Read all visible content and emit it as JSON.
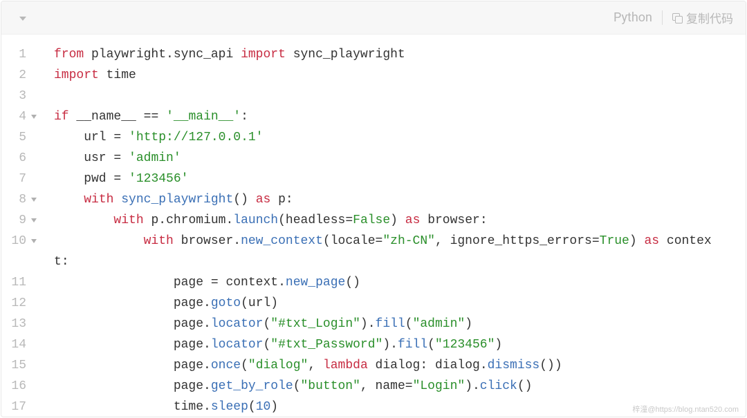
{
  "toolbar": {
    "language_label": "Python",
    "copy_label": "复制代码"
  },
  "code": {
    "lines": [
      {
        "n": "1",
        "fold": false,
        "tokens": [
          [
            "kw",
            "from"
          ],
          [
            "id",
            " playwright"
          ],
          [
            "op",
            "."
          ],
          [
            "id",
            "sync_api "
          ],
          [
            "kw",
            "import"
          ],
          [
            "id",
            " sync_playwright"
          ]
        ]
      },
      {
        "n": "2",
        "fold": false,
        "tokens": [
          [
            "kw",
            "import"
          ],
          [
            "id",
            " time"
          ]
        ]
      },
      {
        "n": "3",
        "fold": false,
        "tokens": []
      },
      {
        "n": "4",
        "fold": true,
        "tokens": [
          [
            "kw",
            "if"
          ],
          [
            "id",
            " __name__ "
          ],
          [
            "op",
            "=="
          ],
          [
            "id",
            " "
          ],
          [
            "str",
            "'__main__'"
          ],
          [
            "op",
            ":"
          ]
        ]
      },
      {
        "n": "5",
        "fold": false,
        "tokens": [
          [
            "id",
            "    url "
          ],
          [
            "op",
            "="
          ],
          [
            "id",
            " "
          ],
          [
            "str",
            "'http://127.0.0.1'"
          ]
        ]
      },
      {
        "n": "6",
        "fold": false,
        "tokens": [
          [
            "id",
            "    usr "
          ],
          [
            "op",
            "="
          ],
          [
            "id",
            " "
          ],
          [
            "str",
            "'admin'"
          ]
        ]
      },
      {
        "n": "7",
        "fold": false,
        "tokens": [
          [
            "id",
            "    pwd "
          ],
          [
            "op",
            "="
          ],
          [
            "id",
            " "
          ],
          [
            "str",
            "'123456'"
          ]
        ]
      },
      {
        "n": "8",
        "fold": true,
        "tokens": [
          [
            "id",
            "    "
          ],
          [
            "kw",
            "with"
          ],
          [
            "id",
            " "
          ],
          [
            "fn",
            "sync_playwright"
          ],
          [
            "op",
            "()"
          ],
          [
            "id",
            " "
          ],
          [
            "kw",
            "as"
          ],
          [
            "id",
            " p"
          ],
          [
            "op",
            ":"
          ]
        ]
      },
      {
        "n": "9",
        "fold": true,
        "tokens": [
          [
            "id",
            "        "
          ],
          [
            "kw",
            "with"
          ],
          [
            "id",
            " p"
          ],
          [
            "op",
            "."
          ],
          [
            "id",
            "chromium"
          ],
          [
            "op",
            "."
          ],
          [
            "fn",
            "launch"
          ],
          [
            "op",
            "("
          ],
          [
            "id",
            "headless"
          ],
          [
            "op",
            "="
          ],
          [
            "bool",
            "False"
          ],
          [
            "op",
            ")"
          ],
          [
            "id",
            " "
          ],
          [
            "kw",
            "as"
          ],
          [
            "id",
            " browser"
          ],
          [
            "op",
            ":"
          ]
        ]
      },
      {
        "n": "10",
        "fold": true,
        "tokens": [
          [
            "id",
            "            "
          ],
          [
            "kw",
            "with"
          ],
          [
            "id",
            " browser"
          ],
          [
            "op",
            "."
          ],
          [
            "fn",
            "new_context"
          ],
          [
            "op",
            "("
          ],
          [
            "id",
            "locale"
          ],
          [
            "op",
            "="
          ],
          [
            "str",
            "\"zh-CN\""
          ],
          [
            "op",
            ","
          ],
          [
            "id",
            " ignore_https_errors"
          ],
          [
            "op",
            "="
          ],
          [
            "bool",
            "True"
          ],
          [
            "op",
            ")"
          ],
          [
            "id",
            " "
          ],
          [
            "kw",
            "as"
          ],
          [
            "id",
            " contex"
          ]
        ]
      },
      {
        "n": "",
        "fold": false,
        "cont": true,
        "tokens": [
          [
            "id",
            "t"
          ],
          [
            "op",
            ":"
          ]
        ]
      },
      {
        "n": "11",
        "fold": false,
        "tokens": [
          [
            "id",
            "                page "
          ],
          [
            "op",
            "="
          ],
          [
            "id",
            " context"
          ],
          [
            "op",
            "."
          ],
          [
            "fn",
            "new_page"
          ],
          [
            "op",
            "()"
          ]
        ]
      },
      {
        "n": "12",
        "fold": false,
        "tokens": [
          [
            "id",
            "                page"
          ],
          [
            "op",
            "."
          ],
          [
            "fn",
            "goto"
          ],
          [
            "op",
            "("
          ],
          [
            "id",
            "url"
          ],
          [
            "op",
            ")"
          ]
        ]
      },
      {
        "n": "13",
        "fold": false,
        "tokens": [
          [
            "id",
            "                page"
          ],
          [
            "op",
            "."
          ],
          [
            "fn",
            "locator"
          ],
          [
            "op",
            "("
          ],
          [
            "str",
            "\"#txt_Login\""
          ],
          [
            "op",
            ")."
          ],
          [
            "fn",
            "fill"
          ],
          [
            "op",
            "("
          ],
          [
            "str",
            "\"admin\""
          ],
          [
            "op",
            ")"
          ]
        ]
      },
      {
        "n": "14",
        "fold": false,
        "tokens": [
          [
            "id",
            "                page"
          ],
          [
            "op",
            "."
          ],
          [
            "fn",
            "locator"
          ],
          [
            "op",
            "("
          ],
          [
            "str",
            "\"#txt_Password\""
          ],
          [
            "op",
            ")."
          ],
          [
            "fn",
            "fill"
          ],
          [
            "op",
            "("
          ],
          [
            "str",
            "\"123456\""
          ],
          [
            "op",
            ")"
          ]
        ]
      },
      {
        "n": "15",
        "fold": false,
        "tokens": [
          [
            "id",
            "                page"
          ],
          [
            "op",
            "."
          ],
          [
            "fn",
            "once"
          ],
          [
            "op",
            "("
          ],
          [
            "str",
            "\"dialog\""
          ],
          [
            "op",
            ","
          ],
          [
            "id",
            " "
          ],
          [
            "kw",
            "lambda"
          ],
          [
            "id",
            " dialog"
          ],
          [
            "op",
            ":"
          ],
          [
            "id",
            " dialog"
          ],
          [
            "op",
            "."
          ],
          [
            "fn",
            "dismiss"
          ],
          [
            "op",
            "())"
          ]
        ]
      },
      {
        "n": "16",
        "fold": false,
        "tokens": [
          [
            "id",
            "                page"
          ],
          [
            "op",
            "."
          ],
          [
            "fn",
            "get_by_role"
          ],
          [
            "op",
            "("
          ],
          [
            "str",
            "\"button\""
          ],
          [
            "op",
            ","
          ],
          [
            "id",
            " name"
          ],
          [
            "op",
            "="
          ],
          [
            "str",
            "\"Login\""
          ],
          [
            "op",
            ")."
          ],
          [
            "fn",
            "click"
          ],
          [
            "op",
            "()"
          ]
        ]
      },
      {
        "n": "17",
        "fold": false,
        "tokens": [
          [
            "id",
            "                time"
          ],
          [
            "op",
            "."
          ],
          [
            "fn",
            "sleep"
          ],
          [
            "op",
            "("
          ],
          [
            "num",
            "10"
          ],
          [
            "op",
            ")"
          ]
        ]
      }
    ]
  },
  "watermark": "梓潼@https://blog.ntan520.com"
}
